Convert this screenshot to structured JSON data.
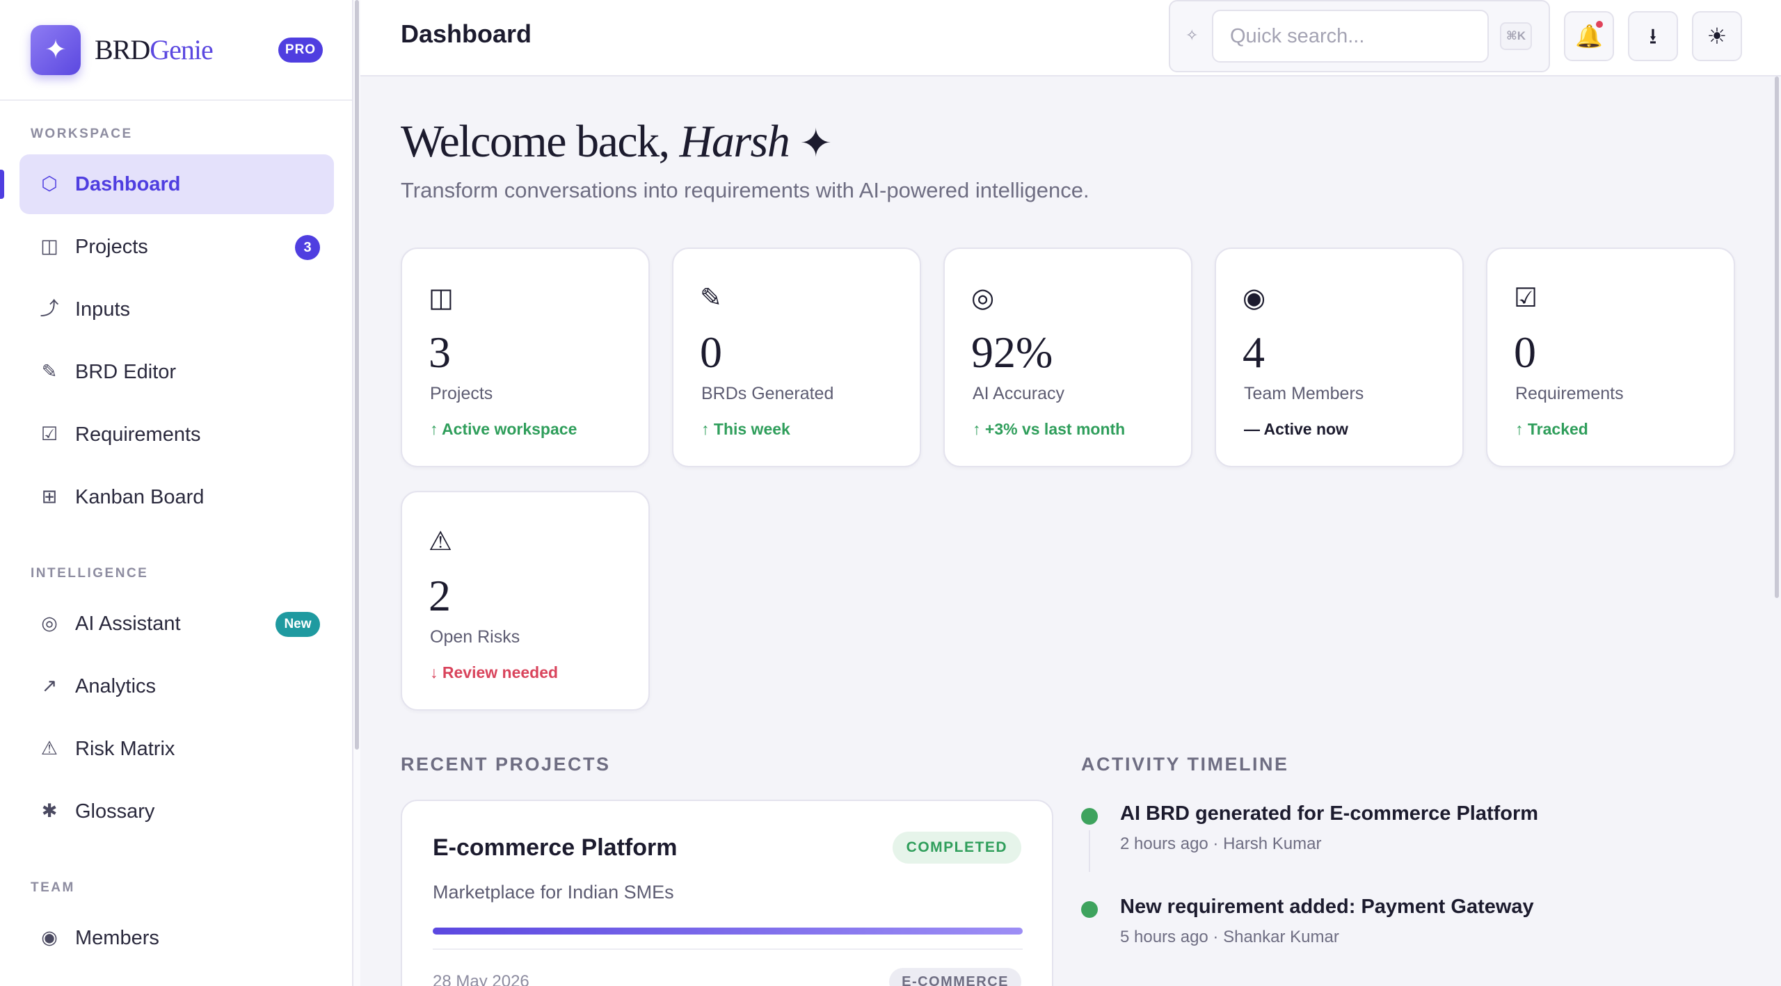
{
  "brand": {
    "logo_glyph": "✦",
    "name_part1": "BRD",
    "name_part2": "Genie",
    "badge": "PRO"
  },
  "sidebar": {
    "sections": {
      "workspace": "WORKSPACE",
      "intelligence": "INTELLIGENCE",
      "team": "TEAM"
    },
    "items": [
      {
        "label": "Dashboard",
        "icon": "⬡",
        "icon_name": "hexagon-icon"
      },
      {
        "label": "Projects",
        "icon": "◫",
        "icon_name": "folder-icon",
        "badge": "3"
      },
      {
        "label": "Inputs",
        "icon": "⤴",
        "icon_name": "arrow-curve-icon"
      },
      {
        "label": "BRD Editor",
        "icon": "✎",
        "icon_name": "pencil-icon"
      },
      {
        "label": "Requirements",
        "icon": "☑",
        "icon_name": "checkbox-icon"
      },
      {
        "label": "Kanban Board",
        "icon": "⊞",
        "icon_name": "grid-icon"
      },
      {
        "label": "AI Assistant",
        "icon": "◎",
        "icon_name": "circle-target-icon",
        "badge": "New"
      },
      {
        "label": "Analytics",
        "icon": "↗",
        "icon_name": "trend-arrow-icon"
      },
      {
        "label": "Risk Matrix",
        "icon": "⚠",
        "icon_name": "warning-icon"
      },
      {
        "label": "Glossary",
        "icon": "✱",
        "icon_name": "asterisk-icon"
      },
      {
        "label": "Members",
        "icon": "◉",
        "icon_name": "members-icon"
      }
    ]
  },
  "header": {
    "title": "Dashboard",
    "search": {
      "placeholder": "Quick search...",
      "spark": "✧",
      "shortcut": "⌘K"
    },
    "notif_icon": "🔔",
    "download_icon": "⭳",
    "theme_icon": "☀"
  },
  "welcome": {
    "prefix": "Welcome back, ",
    "user": "Harsh",
    "spark": "✦",
    "subtitle": "Transform conversations into requirements with AI-powered intelligence."
  },
  "stats": [
    {
      "icon": "◫",
      "value": "3",
      "label": "Projects",
      "trend": "↑ Active workspace"
    },
    {
      "icon": "✎",
      "value": "0",
      "label": "BRDs Generated",
      "trend": "↑ This week"
    },
    {
      "icon": "◎",
      "value": "92%",
      "label": "AI Accuracy",
      "trend": "↑ +3% vs last month"
    },
    {
      "icon": "◉",
      "value": "4",
      "label": "Team Members",
      "trend": "— Active now"
    },
    {
      "icon": "☑",
      "value": "0",
      "label": "Requirements",
      "trend": "↑ Tracked"
    },
    {
      "icon": "⚠",
      "value": "2",
      "label": "Open Risks",
      "trend": "↓ Review needed"
    }
  ],
  "colors": {
    "accent": "#4f3ee0",
    "trend_up": "#2f9e5b",
    "trend_down": "#d9445c",
    "new_badge": "#1f9aa0"
  },
  "recent_projects": {
    "heading": "RECENT PROJECTS",
    "items": [
      {
        "name": "E-commerce Platform",
        "status": "COMPLETED",
        "description": "Marketplace for Indian SMEs",
        "progress": 1.0,
        "date": "28 May 2026",
        "tag": "E-COMMERCE"
      }
    ]
  },
  "timeline": {
    "heading": "ACTIVITY TIMELINE",
    "items": [
      {
        "title": "AI BRD generated for E-commerce Platform",
        "meta": "2 hours ago · Harsh Kumar"
      },
      {
        "title": "New requirement added: Payment Gateway",
        "meta": "5 hours ago · Shankar Kumar"
      }
    ]
  }
}
